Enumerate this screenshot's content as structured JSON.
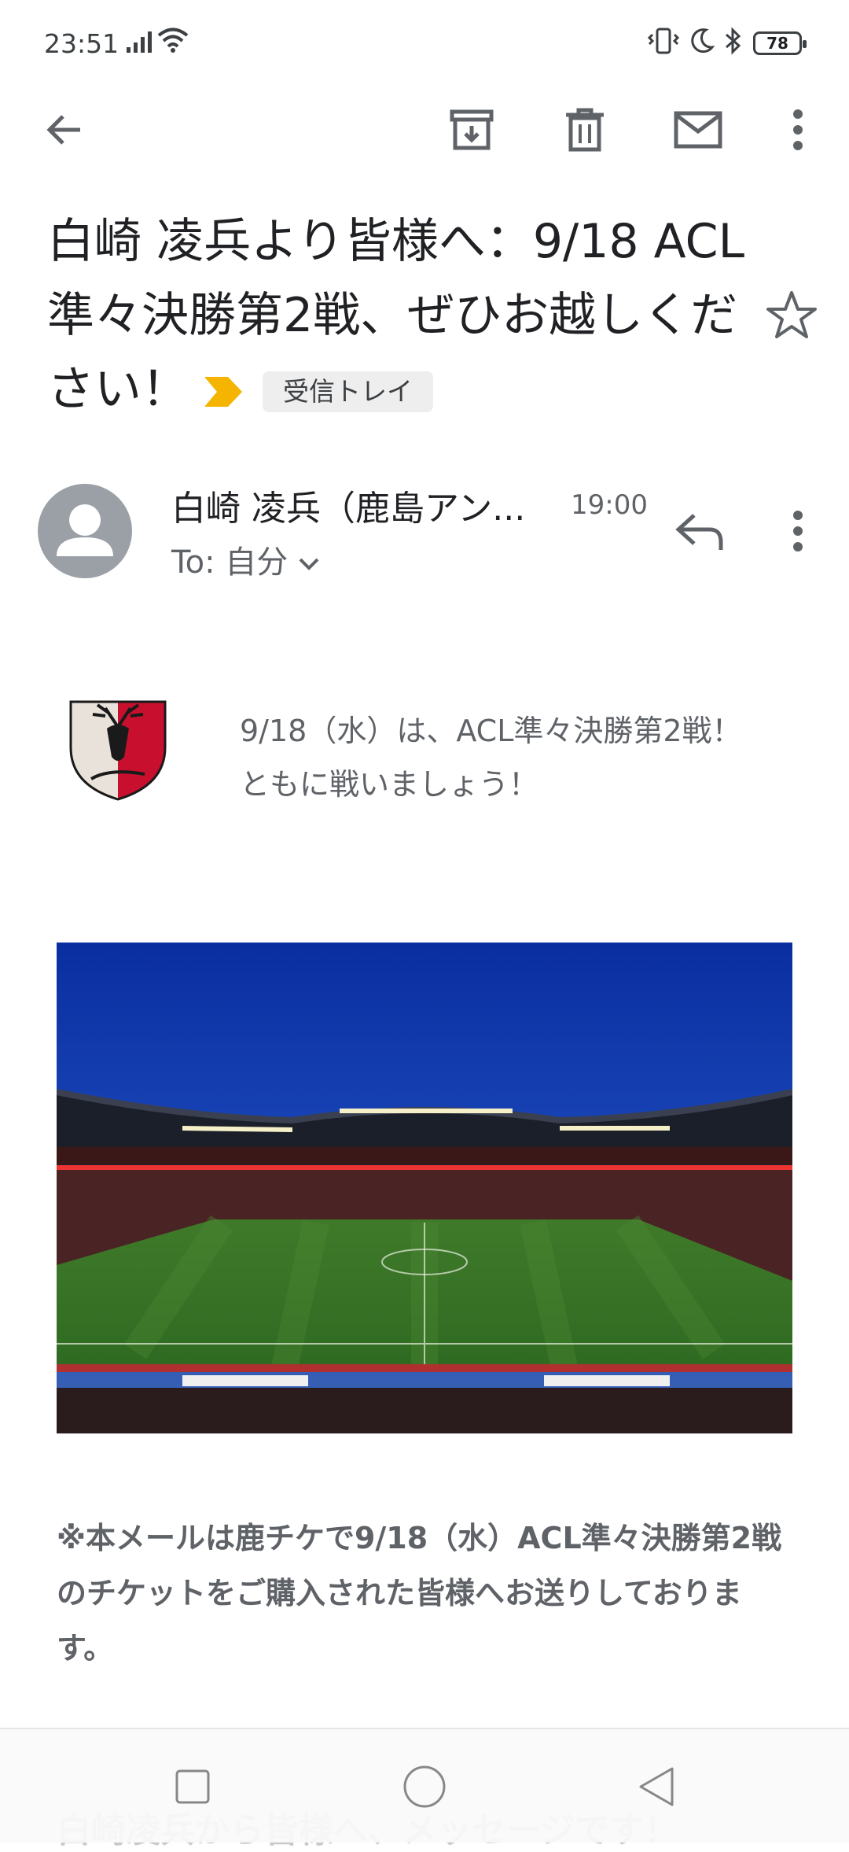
{
  "status_bar": {
    "time": "23:51",
    "battery": "78",
    "icons": [
      "signal-icon",
      "wifi-icon",
      "vibrate-icon",
      "moon-icon",
      "bluetooth-icon",
      "battery-icon"
    ]
  },
  "toolbar": {
    "icons": [
      "back-arrow-icon",
      "archive-icon",
      "delete-icon",
      "mark-unread-icon",
      "more-vert-icon"
    ]
  },
  "email": {
    "subject": "白崎 凌兵より皆様へ：9/18 ACL準々決勝第2戦、ぜひお越しください！",
    "label": "受信トレイ",
    "sender": "白崎 凌兵（鹿島アン...",
    "time": "19:00",
    "to": "To: 自分",
    "intro_line1": "9/18（水）は、ACL準々決勝第2戦！",
    "intro_line2": "ともに戦いましょう！",
    "notice": "※本メールは鹿チケで9/18（水）ACL準々決勝第2戦のチケットをご購入された皆様へお送りしております。",
    "next_line": "白崎凌兵から皆様へ、メッセージです！"
  },
  "colors": {
    "important_marker": "#f4b400",
    "label_bg": "#eeeeee",
    "icon_gray": "#5f6368",
    "avatar_gray": "#9aa0a6",
    "antlers_red": "#c8102e"
  }
}
